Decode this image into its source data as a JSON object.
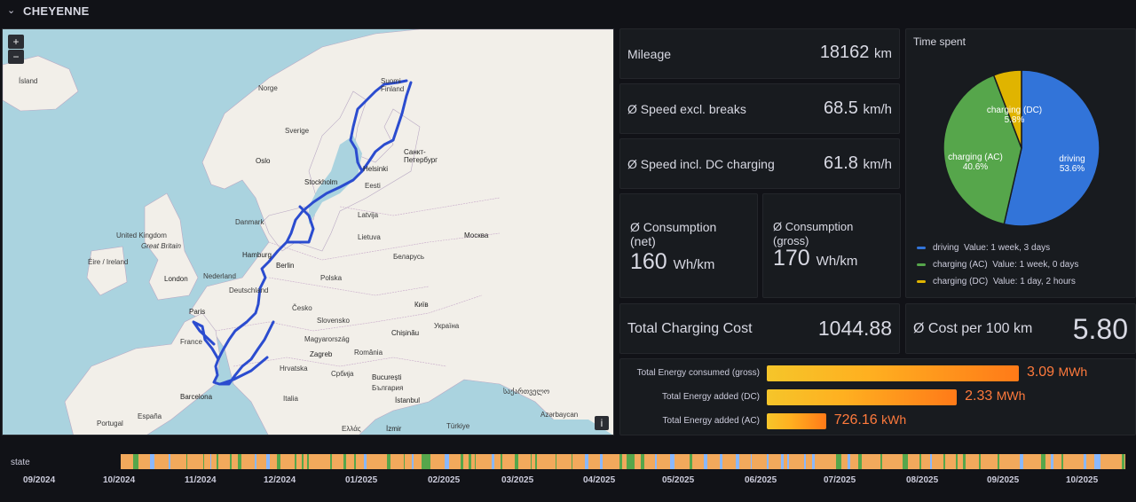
{
  "header": {
    "chevron": "⌄",
    "title": "CHEYENNE"
  },
  "map": {
    "zoom_in": "+",
    "zoom_out": "−",
    "info": "i",
    "labels": {
      "island": "Ísland",
      "norge": "Norge",
      "sverige": "Sverige",
      "suomi": "Suomi",
      "finland": "Finland",
      "oslo": "Oslo",
      "stockholm": "Stockholm",
      "helsinki": "Helsinki",
      "spb": "Санкт-\nПетербург",
      "eesti": "Eesti",
      "latvija": "Latvija",
      "lietuva": "Lietuva",
      "uk": "United Kingdom",
      "gb": "Great Britain",
      "eire": "Éire / Ireland",
      "danmark": "Danmark",
      "hamburg": "Hamburg",
      "berlin": "Berlin",
      "london": "London",
      "nederland": "Nederland",
      "deutschland": "Deutschland",
      "polska": "Polska",
      "belarus": "Беларусь",
      "moskva": "Москва",
      "paris": "Paris",
      "france": "France",
      "cesko": "Česko",
      "slovensko": "Slovensko",
      "kyiv": "Київ",
      "ukraina": "Україна",
      "magyar": "Magyarország",
      "chisinau": "Chișinău",
      "hrvatska": "Hrvatska",
      "zagreb": "Zagreb",
      "romania": "România",
      "srbija": "Србија",
      "bucuresti": "București",
      "bulgaria": "България",
      "italia": "Italia",
      "istanbul": "İstanbul",
      "barcelona": "Barcelona",
      "espana": "España",
      "portugal": "Portugal",
      "turkiye": "Türkiye",
      "izmir": "İzmir",
      "ellas": "Ελλάς",
      "sakartvelo": "საქართველო",
      "azerbaycan": "Azərbaycan"
    }
  },
  "stats": {
    "mileage": {
      "label": "Mileage",
      "value": "18162",
      "unit": "km"
    },
    "speed_excl": {
      "label": "Ø Speed excl. breaks",
      "value": "68.5",
      "unit": "km/h"
    },
    "speed_incl": {
      "label": "Ø Speed incl. DC charging",
      "value": "61.8",
      "unit": "km/h"
    },
    "cons_net": {
      "label1": "Ø Consumption",
      "label2": "(net)",
      "value": "160",
      "unit": "Wh/km"
    },
    "cons_gross": {
      "label1": "Ø Consumption",
      "label2": "(gross)",
      "value": "170",
      "unit": "Wh/km"
    },
    "charging_cost": {
      "label": "Total Charging Cost",
      "value": "1044.88"
    },
    "cost_per_100": {
      "label": "Ø Cost per 100 km",
      "value": "5.80"
    }
  },
  "chart_data": [
    {
      "type": "pie",
      "title": "Time spent",
      "slices": [
        {
          "name": "driving",
          "percent": 53.6,
          "legend_value": "Value: 1 week, 3 days",
          "color": "#3274d9"
        },
        {
          "name": "charging (AC)",
          "percent": 40.6,
          "legend_value": "Value: 1 week, 0 days",
          "color": "#56a64b"
        },
        {
          "name": "charging (DC)",
          "percent": 5.8,
          "legend_value": "Value: 1 day, 2 hours",
          "color": "#e0b400"
        }
      ],
      "slice_labels": [
        "driving\n53.6%",
        "charging (AC)\n40.6%",
        "charging (DC)\n5.8%"
      ],
      "legend_placement": "bottom"
    },
    {
      "type": "bar",
      "orientation": "horizontal",
      "categories": [
        "Total Energy consumed (gross)",
        "Total Energy added (DC)",
        "Total Energy added (AC)"
      ],
      "values_kwh": [
        3090,
        2330,
        726.16
      ],
      "display": [
        {
          "value": "3.09",
          "unit": "MWh"
        },
        {
          "value": "2.33",
          "unit": "MWh"
        },
        {
          "value": "726.16",
          "unit": "kWh"
        }
      ],
      "xlim": [
        0,
        3700
      ]
    },
    {
      "type": "table",
      "kind": "state-timeline",
      "row_label": "state",
      "ticks": [
        "09/2024",
        "10/2024",
        "11/2024",
        "12/2024",
        "01/2025",
        "02/2025",
        "03/2025",
        "04/2025",
        "05/2025",
        "06/2025",
        "07/2025",
        "08/2025",
        "09/2025",
        "10/2025"
      ],
      "state_colors": {
        "driving": "#f2a95c",
        "charging (AC)": "#56a64b",
        "charging (DC)": "#8ab8ff"
      }
    }
  ]
}
